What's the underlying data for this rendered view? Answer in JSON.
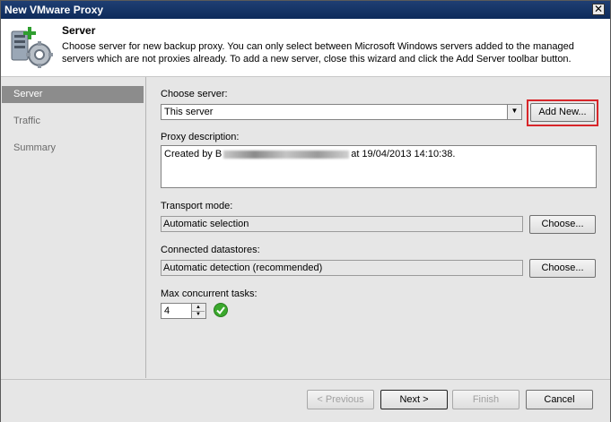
{
  "window": {
    "title": "New VMware Proxy",
    "close_icon": "close-icon",
    "close_label": "✕"
  },
  "header": {
    "title": "Server",
    "description": "Choose server for new backup proxy. You can only select between Microsoft Windows servers added to the managed servers which are not proxies already. To add a new server, close this wizard and click the Add Server toolbar button.",
    "icon": "server-settings-add-icon"
  },
  "sidebar": {
    "items": [
      {
        "label": "Server",
        "active": true
      },
      {
        "label": "Traffic",
        "active": false
      },
      {
        "label": "Summary",
        "active": false
      }
    ]
  },
  "form": {
    "choose_server_label": "Choose server:",
    "choose_server_value": "This server",
    "add_new_label": "Add New...",
    "proxy_desc_label": "Proxy description:",
    "proxy_desc_prefix": "Created by B",
    "proxy_desc_suffix": "at 19/04/2013 14:10:38.",
    "transport_label": "Transport mode:",
    "transport_value": "Automatic selection",
    "transport_choose": "Choose...",
    "datastores_label": "Connected datastores:",
    "datastores_value": "Automatic detection (recommended)",
    "datastores_choose": "Choose...",
    "max_tasks_label": "Max concurrent tasks:",
    "max_tasks_value": "4",
    "status_icon": "green-checkmark-icon"
  },
  "footer": {
    "previous": "< Previous",
    "next": "Next >",
    "finish": "Finish",
    "cancel": "Cancel"
  },
  "colors": {
    "titlebar": "#0d2a5a",
    "highlight": "#d8262a",
    "sidebar_active": "#8c8c8c",
    "check": "#3aa82c"
  }
}
